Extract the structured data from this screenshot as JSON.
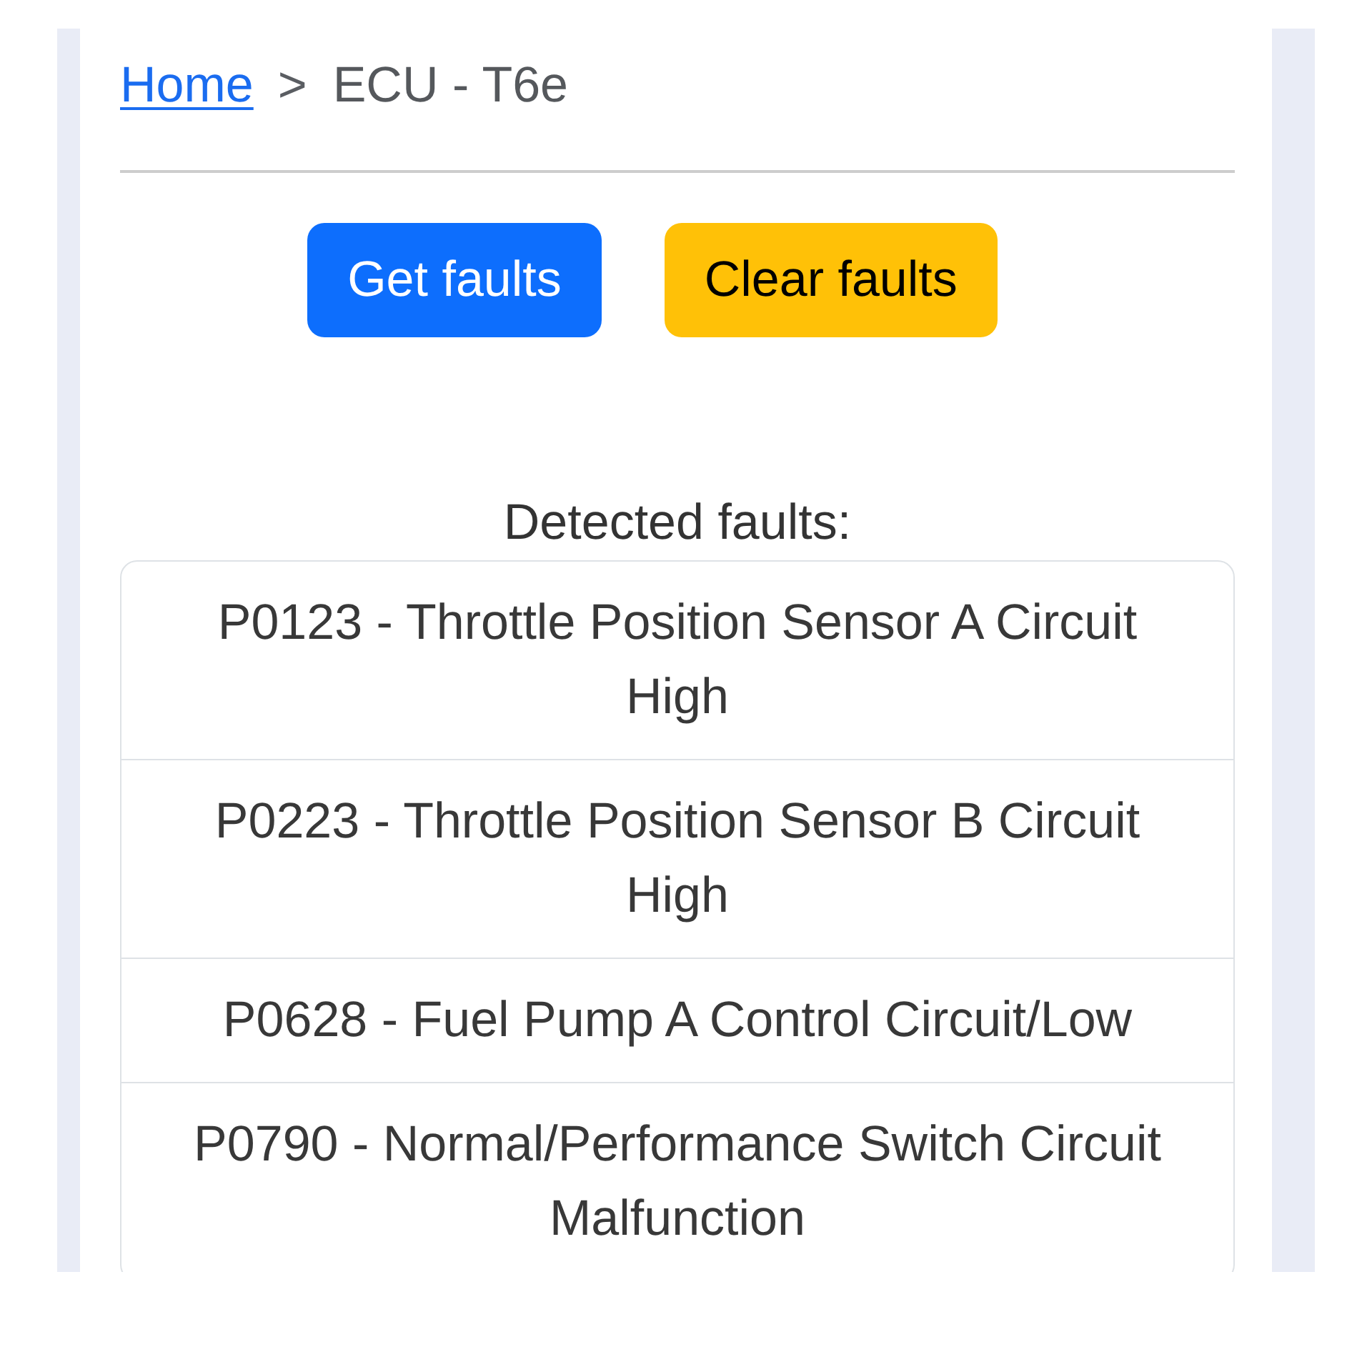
{
  "breadcrumb": {
    "items": [
      {
        "label": "Home",
        "kind": "link"
      },
      {
        "label": "ECU - T6e",
        "kind": "current"
      }
    ],
    "separator": ">"
  },
  "buttons": [
    {
      "label": "Get faults",
      "kind": "primary"
    },
    {
      "label": "Clear faults",
      "kind": "warning"
    }
  ],
  "faults": {
    "heading": "Detected faults:",
    "items": [
      "P0123 - Throttle Position Sensor A Circuit High",
      "P0223 - Throttle Position Sensor B Circuit High",
      "P0628 - Fuel Pump A Control Circuit/Low",
      "P0790 - Normal/Performance Switch Circuit Malfunction"
    ]
  }
}
